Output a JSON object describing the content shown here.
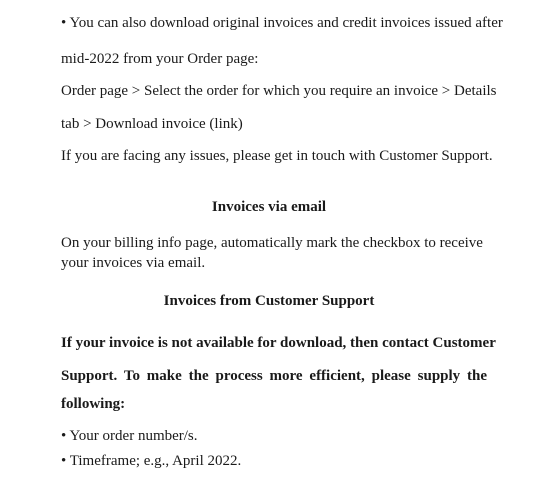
{
  "download_section": {
    "bullet": "•",
    "line1": "You can also download original invoices and credit invoices issued after",
    "line2": "mid-2022 from your Order page:",
    "path_line1": "Order page > Select the order for which you require an invoice > Details",
    "path_line2": "tab > Download invoice (link)",
    "issues": "If you are facing any issues, please get in touch with Customer Support."
  },
  "email_section": {
    "heading": "Invoices via email",
    "line1": "On your billing info page, automatically mark the checkbox to receive",
    "line2": "your invoices via email."
  },
  "support_section": {
    "heading": "Invoices from Customer Support",
    "para_line1": "If your invoice is not available for download, then contact Customer",
    "para_line2": "Support. To make the process more efficient, please supply the",
    "para_line3": "following:",
    "bullets": [
      "Your order number/s.",
      "Timeframe; e.g., April 2022."
    ]
  }
}
